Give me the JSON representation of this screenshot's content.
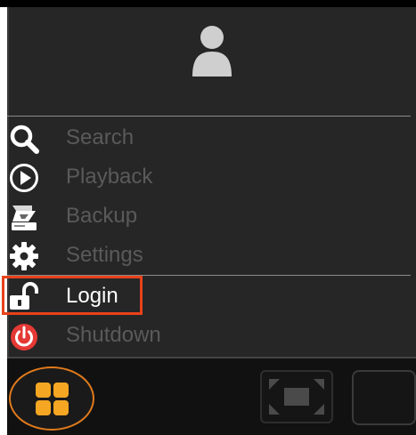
{
  "menu": {
    "items": [
      {
        "label": "Search",
        "icon": "search-icon"
      },
      {
        "label": "Playback",
        "icon": "play-circle-icon"
      },
      {
        "label": "Backup",
        "icon": "backup-drive-icon"
      },
      {
        "label": "Settings",
        "icon": "gear-icon"
      },
      {
        "label": "Login",
        "icon": "unlock-icon"
      },
      {
        "label": "Shutdown",
        "icon": "power-icon"
      }
    ],
    "highlighted": "Login"
  },
  "colors": {
    "panel": "#262626",
    "label_inactive": "#5a5a5a",
    "label_active": "#ffffff",
    "highlight": "#e8421a",
    "start_button": "#f5a623",
    "power": "#e53935"
  },
  "taskbar": {
    "start_icon": "grid-icon",
    "fullscreen_icon": "fullscreen-icon",
    "window_icon": "window-icon"
  }
}
